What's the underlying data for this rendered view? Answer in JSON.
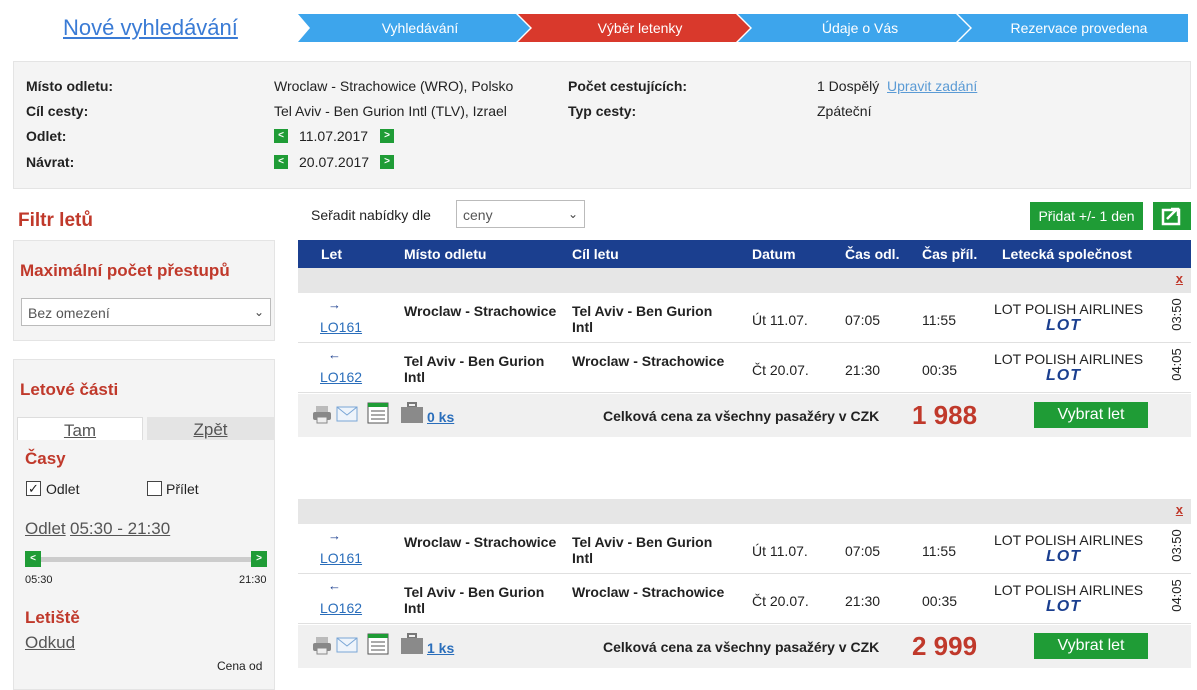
{
  "header": {
    "new_search": "Nové vyhledávání",
    "steps": [
      "Vyhledávání",
      "Výběr letenky",
      "Údaje o Vás",
      "Rezervace provedena"
    ]
  },
  "summary": {
    "from_label": "Místo odletu:",
    "from_value": "Wroclaw - Strachowice (WRO), Polsko",
    "to_label": "Cíl cesty:",
    "to_value": "Tel Aviv - Ben Gurion Intl (TLV), Izrael",
    "dep_label": "Odlet:",
    "dep_value": "11.07.2017",
    "ret_label": "Návrat:",
    "ret_value": "20.07.2017",
    "pax_label": "Počet cestujících:",
    "pax_value": "1 Dospělý",
    "edit_link": "Upravit zadání",
    "trip_label": "Typ cesty:",
    "trip_value": "Zpáteční",
    "prev_symbol": "<",
    "next_symbol": ">"
  },
  "filter": {
    "title": "Filtr letů",
    "max_transfers_title": "Maximální počet přestupů",
    "max_transfers_value": "Bez omezení",
    "segments_title": "Letové části",
    "tab_there": "Tam",
    "tab_back": "Zpět",
    "times_title": "Časy",
    "cb_departure": "Odlet",
    "cb_arrival": "Přílet",
    "time_label": "Odlet",
    "time_range": "05:30 - 21:30",
    "slider_min": "05:30",
    "slider_max": "21:30",
    "airports_title": "Letiště",
    "from_label": "Odkud",
    "price_from": "Cena od"
  },
  "results": {
    "sort_label": "Seřadit nabídky dle",
    "sort_value": "ceny",
    "add_day_button": "Přidat +/- 1 den",
    "columns": [
      "Let",
      "Místo odletu",
      "Cíl letu",
      "Datum",
      "Čas odl.",
      "Čas příl.",
      "Letecká společnost"
    ],
    "offers": [
      {
        "close": "x",
        "flights": [
          {
            "arrow": "→",
            "number": "LO161",
            "from": "Wroclaw - Strachowice",
            "to": "Tel Aviv - Ben Gurion Intl",
            "date": "Út 11.07.",
            "dep": "07:05",
            "arr": "11:55",
            "airline": "LOT POLISH AIRLINES",
            "logo": "LOT",
            "duration": "03:50"
          },
          {
            "arrow": "←",
            "number": "LO162",
            "from": "Tel Aviv - Ben Gurion Intl",
            "to": "Wroclaw - Strachowice",
            "date": "Čt 20.07.",
            "dep": "21:30",
            "arr": "00:35",
            "airline": "LOT POLISH AIRLINES",
            "logo": "LOT",
            "duration": "04:05"
          }
        ],
        "bags": "0 ks",
        "total_label": "Celková cena za všechny pasažéry v CZK",
        "price": "1 988",
        "select_button": "Vybrat let"
      },
      {
        "close": "x",
        "flights": [
          {
            "arrow": "→",
            "number": "LO161",
            "from": "Wroclaw - Strachowice",
            "to": "Tel Aviv - Ben Gurion Intl",
            "date": "Út 11.07.",
            "dep": "07:05",
            "arr": "11:55",
            "airline": "LOT POLISH AIRLINES",
            "logo": "LOT",
            "duration": "03:50"
          },
          {
            "arrow": "←",
            "number": "LO162",
            "from": "Tel Aviv - Ben Gurion Intl",
            "to": "Wroclaw - Strachowice",
            "date": "Čt 20.07.",
            "dep": "21:30",
            "arr": "00:35",
            "airline": "LOT POLISH AIRLINES",
            "logo": "LOT",
            "duration": "04:05"
          }
        ],
        "bags": "1 ks",
        "total_label": "Celková cena za všechny pasažéry v CZK",
        "price": "2 999",
        "select_button": "Vybrat let"
      }
    ]
  },
  "colors": {
    "accent_red": "#c0392b",
    "step_blue": "#3da5ec",
    "step_active": "#d9392c",
    "header_navy": "#1b3f8f",
    "button_green": "#1f9c36"
  }
}
